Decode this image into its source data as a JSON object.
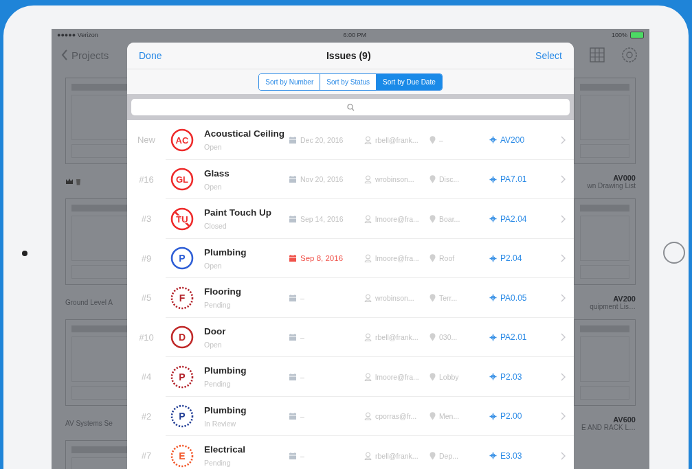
{
  "status_bar": {
    "carrier": "●●●●● Verizon",
    "time": "6:00 PM",
    "battery": "100%"
  },
  "nav": {
    "back": "Projects"
  },
  "left_sheets": [
    {
      "kind": "icons"
    },
    {
      "kind": "label",
      "title": "Ground Level A"
    },
    {
      "kind": "label",
      "title": "AV Systems Se"
    },
    {
      "kind": "none"
    }
  ],
  "right_sheets": [
    {
      "number": "AV000",
      "title": "wn Drawing List"
    },
    {
      "number": "AV200",
      "title": "quipment Lis…"
    },
    {
      "number": "AV600",
      "title": "E AND RACK L…"
    }
  ],
  "modal": {
    "done": "Done",
    "title": "Issues (9)",
    "select": "Select"
  },
  "sort_tabs": [
    {
      "label": "Sort by Number",
      "selected": false
    },
    {
      "label": "Sort by Status",
      "selected": false
    },
    {
      "label": "Sort by Due Date",
      "selected": true
    }
  ],
  "issues": [
    {
      "number": "New",
      "letters": "AC",
      "dashed": false,
      "struck": false,
      "color": "#ee2b2b",
      "title": "Acoustical Ceiling",
      "status": "Open",
      "due": "Dec 20, 2016",
      "overdue": false,
      "assignee": "rbell@frank...",
      "location": "–",
      "sheet": "AV200"
    },
    {
      "number": "#16",
      "letters": "GL",
      "dashed": false,
      "struck": false,
      "color": "#ee2b2b",
      "title": "Glass",
      "status": "Open",
      "due": "Nov 20, 2016",
      "overdue": false,
      "assignee": "wrobinson...",
      "location": "Disc...",
      "sheet": "PA7.01"
    },
    {
      "number": "#3",
      "letters": "TU",
      "dashed": false,
      "struck": true,
      "color": "#ee2b2b",
      "title": "Paint Touch Up",
      "status": "Closed",
      "due": "Sep 14, 2016",
      "overdue": false,
      "assignee": "lmoore@fra...",
      "location": "Boar...",
      "sheet": "PA2.04"
    },
    {
      "number": "#9",
      "letters": "P",
      "dashed": false,
      "struck": false,
      "color": "#2f5fd6",
      "title": "Plumbing",
      "status": "Open",
      "due": "Sep 8, 2016",
      "overdue": true,
      "assignee": "lmoore@fra...",
      "location": "Roof",
      "sheet": "P2.04"
    },
    {
      "number": "#5",
      "letters": "F",
      "dashed": true,
      "struck": false,
      "color": "#b3222a",
      "title": "Flooring",
      "status": "Pending",
      "due": "–",
      "overdue": false,
      "assignee": "wrobinson...",
      "location": "Terr...",
      "sheet": "PA0.05"
    },
    {
      "number": "#10",
      "letters": "D",
      "dashed": false,
      "struck": false,
      "color": "#c02a2a",
      "title": "Door",
      "status": "Open",
      "due": "–",
      "overdue": false,
      "assignee": "rbell@frank...",
      "location": "030...",
      "sheet": "PA2.01"
    },
    {
      "number": "#4",
      "letters": "P",
      "dashed": true,
      "struck": false,
      "color": "#b3222a",
      "title": "Plumbing",
      "status": "Pending",
      "due": "–",
      "overdue": false,
      "assignee": "lmoore@fra...",
      "location": "Lobby",
      "sheet": "P2.03"
    },
    {
      "number": "#2",
      "letters": "P",
      "dashed": true,
      "struck": false,
      "color": "#233f96",
      "title": "Plumbing",
      "status": "In Review",
      "due": "–",
      "overdue": false,
      "assignee": "cporras@fr...",
      "location": "Men...",
      "sheet": "P2.00"
    },
    {
      "number": "#7",
      "letters": "E",
      "dashed": true,
      "struck": false,
      "color": "#f2582a",
      "title": "Electrical",
      "status": "Pending",
      "due": "–",
      "overdue": false,
      "assignee": "rbell@frank...",
      "location": "Dep...",
      "sheet": "E3.03"
    }
  ]
}
